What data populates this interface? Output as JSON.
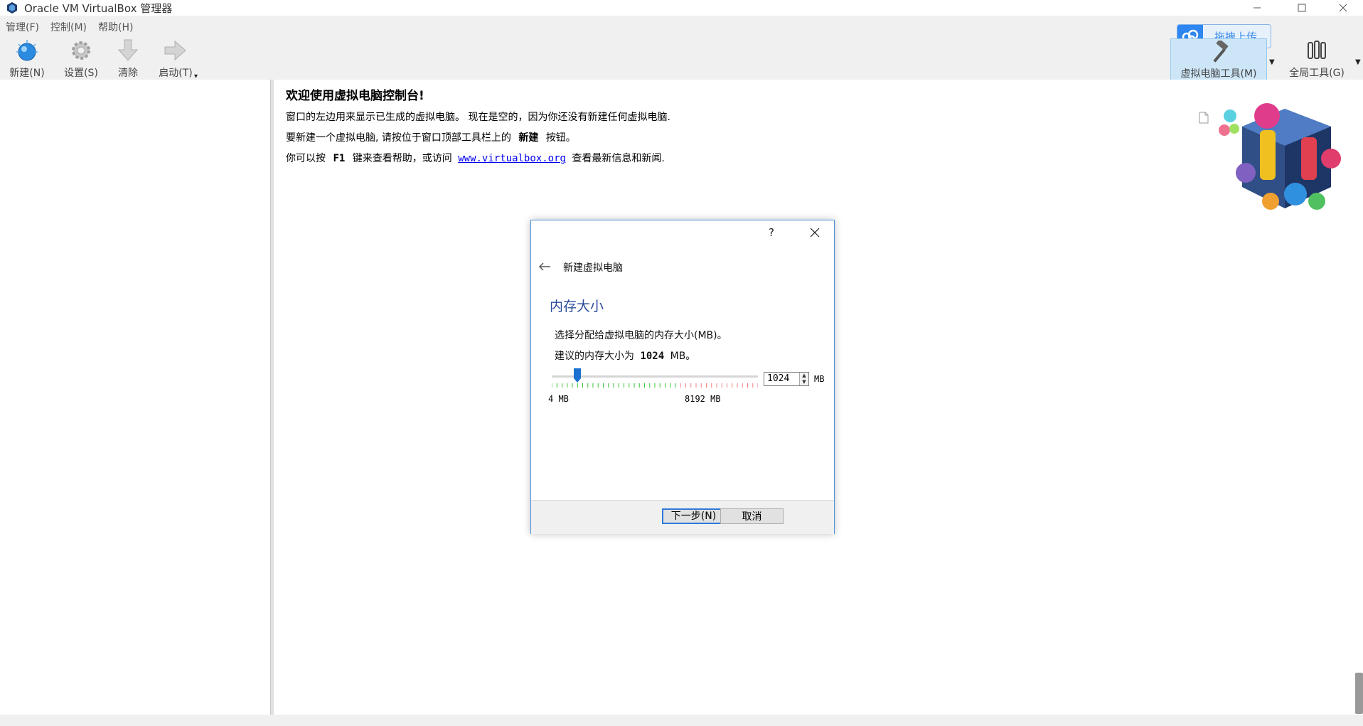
{
  "window": {
    "title": "Oracle VM VirtualBox 管理器",
    "controls": [
      "minimize-icon",
      "maximize-icon",
      "close-icon"
    ]
  },
  "menu": [
    "管理(F)",
    "控制(M)",
    "帮助(H)"
  ],
  "toolbar": {
    "new_label": "新建(N)",
    "settings_label": "设置(S)",
    "discard_label": "清除",
    "start_label": "启动(T)",
    "vm_tools_label": "虚拟电脑工具(M)",
    "global_tools_label": "全局工具(G)"
  },
  "upload": {
    "label": "拖拽上传"
  },
  "welcome": {
    "title": "欢迎使用虚拟电脑控制台!",
    "line1": "窗口的左边用来显示已生成的虚拟电脑。 现在是空的，因为你还没有新建任何虚拟电脑.",
    "line2_pre": "要新建一个虚拟电脑, 请按位于窗口顶部工具栏上的",
    "line2_bold": "新建",
    "line2_post": "按钮。",
    "line3_pre": "你可以按",
    "line3_key": "F1",
    "line3_mid": "键来查看帮助，或访问",
    "line3_link": "www.virtualbox.org",
    "line3_post": "查看最新信息和新闻."
  },
  "dialog": {
    "help": "?",
    "title": "新建虚拟电脑",
    "section": "内存大小",
    "desc1": "选择分配给虚拟电脑的内存大小(MB)。",
    "desc2_pre": "建议的内存大小为",
    "desc2_value": "1024",
    "desc2_post": "MB。",
    "memory_value": "1024",
    "unit": "MB",
    "min_label": "4 MB",
    "max_label": "8192 MB",
    "slider": {
      "min": 4,
      "max": 8192,
      "value": 1024,
      "recommended_max": 5000
    },
    "next_label": "下一步(N)",
    "cancel_label": "取消"
  },
  "colors": {
    "accent": "#2f78d8",
    "section_title": "#2c4c9c",
    "link": "#0000ee",
    "tick_ok": "#36c236",
    "tick_warn": "#f08080"
  }
}
